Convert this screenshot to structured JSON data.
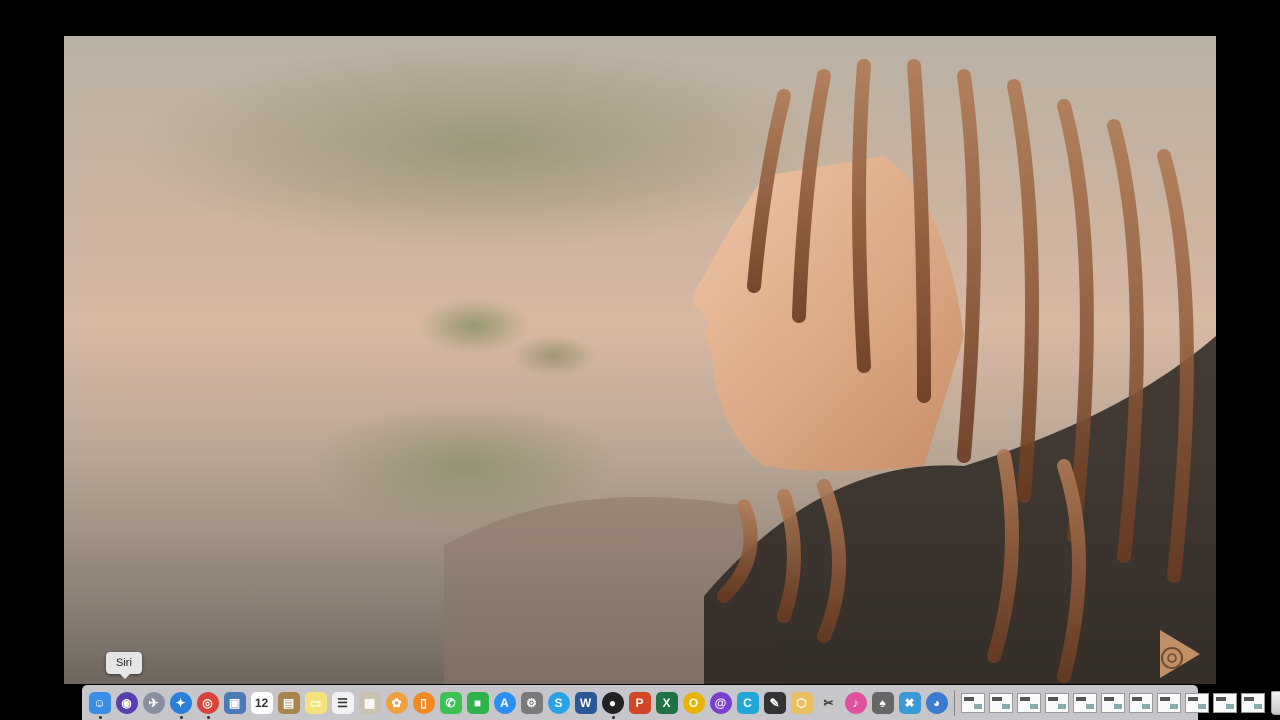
{
  "tooltip": {
    "label": "Siri"
  },
  "dock": {
    "apps": [
      {
        "name": "finder-icon",
        "glyph": "☺",
        "color": "#3a8ee6",
        "running": true
      },
      {
        "name": "siri-icon",
        "glyph": "◉",
        "color": "#5a3fb0",
        "running": false,
        "round": true
      },
      {
        "name": "launchpad-icon",
        "glyph": "✈",
        "color": "#8a8fa0",
        "running": false,
        "round": true
      },
      {
        "name": "safari-icon",
        "glyph": "✦",
        "color": "#2a7fd8",
        "running": true,
        "round": true
      },
      {
        "name": "chrome-icon",
        "glyph": "◎",
        "color": "#d9443a",
        "running": true,
        "round": true
      },
      {
        "name": "preview-icon",
        "glyph": "▣",
        "color": "#4a7ab8",
        "running": false
      },
      {
        "name": "calendar-icon",
        "glyph": "12",
        "color": "#ffffff",
        "running": false,
        "dark": true
      },
      {
        "name": "notes-brown-icon",
        "glyph": "▤",
        "color": "#a8844e",
        "running": false
      },
      {
        "name": "notes-icon",
        "glyph": "▭",
        "color": "#f6e27a",
        "running": false
      },
      {
        "name": "reminders-icon",
        "glyph": "☰",
        "color": "#f2f2f2",
        "running": false,
        "dark": true
      },
      {
        "name": "contacts-icon",
        "glyph": "▦",
        "color": "#c9c2b0",
        "running": false
      },
      {
        "name": "photos-icon",
        "glyph": "✿",
        "color": "#f0a040",
        "running": false,
        "round": true
      },
      {
        "name": "books-icon",
        "glyph": "▯",
        "color": "#f08a20",
        "running": false,
        "round": true
      },
      {
        "name": "messages-icon",
        "glyph": "✆",
        "color": "#3cc253",
        "running": false
      },
      {
        "name": "facetime-icon",
        "glyph": "■",
        "color": "#2fb24a",
        "running": false
      },
      {
        "name": "app-store-icon",
        "glyph": "A",
        "color": "#2d8ff0",
        "running": false,
        "round": true
      },
      {
        "name": "system-preferences-icon",
        "glyph": "⚙",
        "color": "#7a7a7a",
        "running": false
      },
      {
        "name": "skype-icon",
        "glyph": "S",
        "color": "#2aa2e8",
        "running": false,
        "round": true
      },
      {
        "name": "word-icon",
        "glyph": "W",
        "color": "#2b5797",
        "running": false
      },
      {
        "name": "obs-icon",
        "glyph": "●",
        "color": "#222222",
        "running": true,
        "round": true
      },
      {
        "name": "powerpoint-icon",
        "glyph": "P",
        "color": "#d24726",
        "running": false
      },
      {
        "name": "excel-icon",
        "glyph": "X",
        "color": "#1f7244",
        "running": false
      },
      {
        "name": "outlook-icon",
        "glyph": "O",
        "color": "#e8b400",
        "running": false,
        "round": true
      },
      {
        "name": "spiral-app-icon",
        "glyph": "@",
        "color": "#7a3fd0",
        "running": false,
        "round": true
      },
      {
        "name": "c-app-icon",
        "glyph": "C",
        "color": "#22a8d8",
        "running": false
      },
      {
        "name": "final-cut-icon",
        "glyph": "✎",
        "color": "#333333",
        "running": false
      },
      {
        "name": "package-icon",
        "glyph": "⬡",
        "color": "#e8c060",
        "running": false
      },
      {
        "name": "scissors-app-icon",
        "glyph": "✂",
        "color": "#c8c8c8",
        "running": false,
        "dark": true
      },
      {
        "name": "itunes-icon",
        "glyph": "♪",
        "color": "#e050a0",
        "running": false,
        "round": true
      },
      {
        "name": "pen-tool-icon",
        "glyph": "♠",
        "color": "#666666",
        "running": false
      },
      {
        "name": "x-app-icon",
        "glyph": "✖",
        "color": "#3a9ad8",
        "running": false
      },
      {
        "name": "proxy-app-icon",
        "glyph": "◕",
        "color": "#3a7ad0",
        "running": false,
        "round": true
      }
    ],
    "windows": [
      {
        "name": "minimized-window-1"
      },
      {
        "name": "minimized-window-2"
      },
      {
        "name": "minimized-window-3"
      },
      {
        "name": "minimized-window-4"
      },
      {
        "name": "minimized-window-5"
      },
      {
        "name": "minimized-window-6"
      },
      {
        "name": "minimized-window-7"
      },
      {
        "name": "minimized-window-8"
      },
      {
        "name": "minimized-window-9"
      },
      {
        "name": "minimized-window-10"
      },
      {
        "name": "minimized-window-11"
      }
    ]
  }
}
